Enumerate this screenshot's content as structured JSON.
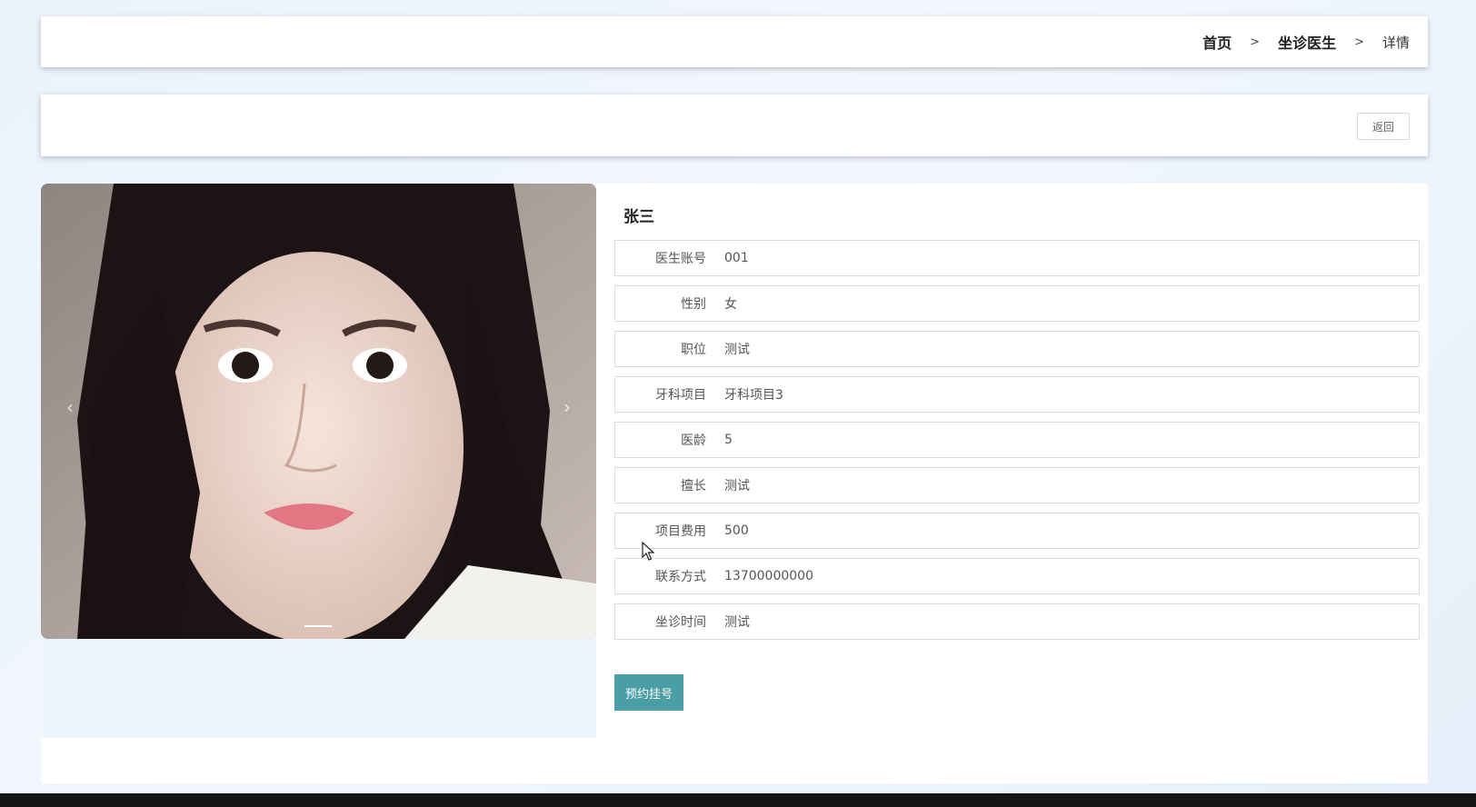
{
  "breadcrumb": {
    "home": "首页",
    "doctors": "坐诊医生",
    "current": "详情",
    "separator": ">"
  },
  "toolbar": {
    "back_label": "返回"
  },
  "doctor": {
    "name": "张三",
    "fields": [
      {
        "label": "医生账号",
        "value": "001"
      },
      {
        "label": "性别",
        "value": "女"
      },
      {
        "label": "职位",
        "value": "测试"
      },
      {
        "label": "牙科项目",
        "value": "牙科项目3"
      },
      {
        "label": "医龄",
        "value": "5"
      },
      {
        "label": "擅长",
        "value": "测试"
      },
      {
        "label": "项目费用",
        "value": "500"
      },
      {
        "label": "联系方式",
        "value": "13700000000"
      },
      {
        "label": "坐诊时间",
        "value": "测试"
      }
    ]
  },
  "carousel": {
    "prev_icon": "‹",
    "next_icon": "›"
  },
  "actions": {
    "book_label": "预约挂号"
  },
  "colors": {
    "accent": "#4a9ea6",
    "background": "#eaf2fb"
  }
}
